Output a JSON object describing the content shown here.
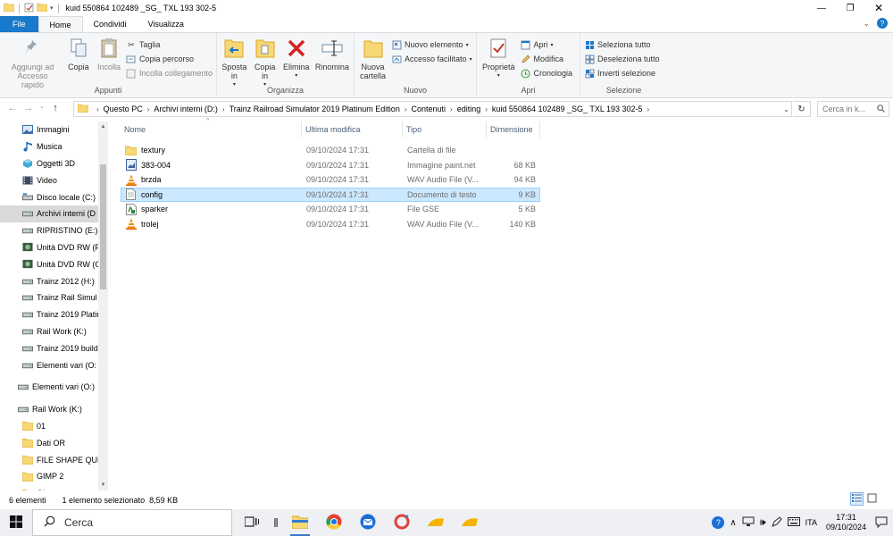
{
  "window": {
    "title": "kuid 550864 102489 _SG_ TXL 193 302-5",
    "minimize_icon": "minimize-icon",
    "maximize_icon": "restore-icon",
    "close_icon": "close-icon"
  },
  "tabs": [
    {
      "label": "File"
    },
    {
      "label": "Home"
    },
    {
      "label": "Condividi"
    },
    {
      "label": "Visualizza"
    }
  ],
  "ribbon": {
    "appunti": {
      "label": "Appunti",
      "pin": "Aggiungi ad\nAccesso rapido",
      "copy": "Copia",
      "paste": "Incolla",
      "cut": "Taglia",
      "copy_path": "Copia percorso",
      "paste_link": "Incolla collegamento"
    },
    "organizza": {
      "label": "Organizza",
      "move_to": "Sposta\nin",
      "copy_to": "Copia\nin",
      "delete": "Elimina",
      "rename": "Rinomina"
    },
    "nuovo": {
      "label": "Nuovo",
      "new_folder": "Nuova\ncartella",
      "new_item": "Nuovo elemento",
      "easy_access": "Accesso facilitato"
    },
    "apri": {
      "label": "Apri",
      "properties": "Proprietà",
      "open": "Apri",
      "edit": "Modifica",
      "history": "Cronologia"
    },
    "selezione": {
      "label": "Selezione",
      "select_all": "Seleziona tutto",
      "select_none": "Deseleziona tutto",
      "invert": "Inverti selezione"
    }
  },
  "address": {
    "crumbs": [
      "Questo PC",
      "Archivi interni (D:)",
      "Trainz Railroad Simulator 2019 Platinum Edition",
      "Contenuti",
      "editing",
      "kuid 550864 102489 _SG_ TXL 193 302-5"
    ],
    "search_placeholder": "Cerca in k..."
  },
  "nav": [
    {
      "label": "Immagini",
      "icon": "pictures-icon"
    },
    {
      "label": "Musica",
      "icon": "music-icon"
    },
    {
      "label": "Oggetti 3D",
      "icon": "objects-3d-icon"
    },
    {
      "label": "Video",
      "icon": "video-icon"
    },
    {
      "label": "Disco locale (C:)",
      "icon": "drive-c-icon"
    },
    {
      "label": "Archivi interni (D",
      "icon": "drive-icon",
      "selected": true
    },
    {
      "label": "RIPRISTINO (E:)",
      "icon": "drive-icon"
    },
    {
      "label": "Unità DVD RW (F",
      "icon": "dvd-icon"
    },
    {
      "label": "Unità DVD RW (G",
      "icon": "dvd-icon"
    },
    {
      "label": "Trainz 2012 (H:)",
      "icon": "drive-icon"
    },
    {
      "label": "Trainz Rail Simul",
      "icon": "drive-icon"
    },
    {
      "label": "Trainz 2019 Platir",
      "icon": "drive-icon"
    },
    {
      "label": "Rail Work (K:)",
      "icon": "drive-icon"
    },
    {
      "label": "Trainz 2019 build",
      "icon": "drive-icon"
    },
    {
      "label": "Elementi vari (O:",
      "icon": "drive-icon"
    },
    {
      "label": "Elementi vari (O:)",
      "icon": "drive-icon",
      "top": true
    },
    {
      "label": "Rail Work (K:)",
      "icon": "drive-icon",
      "top": true
    },
    {
      "label": "01",
      "icon": "folder-icon"
    },
    {
      "label": "Dati OR",
      "icon": "folder-icon"
    },
    {
      "label": "FILE SHAPE QUE",
      "icon": "folder-icon"
    },
    {
      "label": "GIMP 2",
      "icon": "folder-icon"
    },
    {
      "label": "Giorno",
      "icon": "folder-icon"
    }
  ],
  "columns": {
    "name": "Nome",
    "date": "Ultima modifica",
    "type": "Tipo",
    "size": "Dimensione"
  },
  "files": [
    {
      "name": "textury",
      "date": "09/10/2024 17:31",
      "type": "Cartella di file",
      "size": "",
      "icon": "folder-icon"
    },
    {
      "name": "383-004",
      "date": "09/10/2024 17:31",
      "type": "Immagine paint.net",
      "size": "68 KB",
      "icon": "paintnet-image-icon"
    },
    {
      "name": "brzda",
      "date": "09/10/2024 17:31",
      "type": "WAV Audio File (V...",
      "size": "94 KB",
      "icon": "vlc-icon"
    },
    {
      "name": "config",
      "date": "09/10/2024 17:31",
      "type": "Documento di testo",
      "size": "9 KB",
      "icon": "text-document-icon",
      "selected": true
    },
    {
      "name": "sparker",
      "date": "09/10/2024 17:31",
      "type": "File GSE",
      "size": "5 KB",
      "icon": "gse-file-icon"
    },
    {
      "name": "trolej",
      "date": "09/10/2024 17:31",
      "type": "WAV Audio File (V...",
      "size": "140 KB",
      "icon": "vlc-icon"
    }
  ],
  "status": {
    "count": "6 elementi",
    "selection": "1 elemento selezionato  8,59 KB"
  },
  "taskbar": {
    "search": "Cerca",
    "language": "ITA",
    "time": "17:31",
    "date": "09/10/2024"
  },
  "colors": {
    "accent": "#1979ca",
    "selection": "#cce8ff",
    "folder": "#f8d775"
  }
}
